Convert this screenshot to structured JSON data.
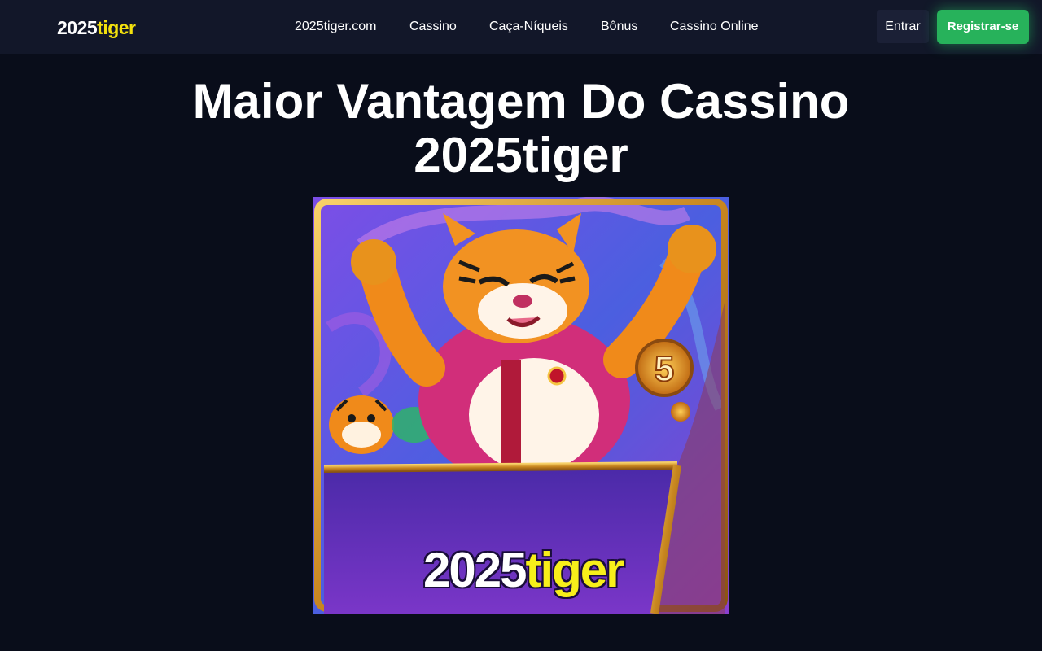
{
  "header": {
    "logo_number": "2025",
    "logo_word": "tiger",
    "nav": [
      {
        "label": "2025tiger.com"
      },
      {
        "label": "Cassino"
      },
      {
        "label": "Caça-Níqueis"
      },
      {
        "label": "Bônus"
      },
      {
        "label": "Cassino Online"
      }
    ],
    "login_label": "Entrar",
    "register_label": "Registrar-se"
  },
  "hero": {
    "title": "Maior Vantagem Do Cassino 2025tiger"
  },
  "banner": {
    "logo_number": "2025",
    "logo_word": "tiger",
    "coin_label": "5"
  },
  "colors": {
    "page_background": "#090d1a",
    "header_background": "#121729",
    "brand_yellow": "#f3e10d",
    "register_green": "#27b25b"
  }
}
